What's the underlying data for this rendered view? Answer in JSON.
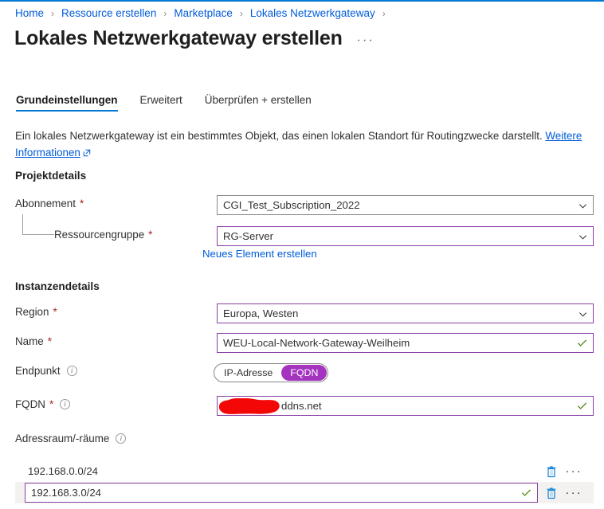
{
  "theme": {
    "accent_blue": "#0078d4",
    "link_blue": "#015cda",
    "purple_border": "#8a3fa4",
    "pill_purple": "#a434c0",
    "required_red": "#a4262c",
    "valid_green": "#498205",
    "selected_row_bg": "#f3f2f1",
    "redaction_red": "#f30707"
  },
  "breadcrumb": {
    "separator": "›",
    "items": [
      {
        "label": "Home"
      },
      {
        "label": "Ressource erstellen"
      },
      {
        "label": "Marketplace"
      },
      {
        "label": "Lokales Netzwerkgateway"
      }
    ]
  },
  "header": {
    "title": "Lokales Netzwerkgateway erstellen",
    "more_actions": "···"
  },
  "tabs": [
    {
      "label": "Grundeinstellungen",
      "active": true
    },
    {
      "label": "Erweitert",
      "active": false
    },
    {
      "label": "Überprüfen + erstellen",
      "active": false
    }
  ],
  "description": {
    "text": "Ein lokales Netzwerkgateway ist ein bestimmtes Objekt, das einen lokalen Standort für Routingzwecke darstellt.",
    "link_text": "Weitere Informationen",
    "link_icon": "external-link-icon"
  },
  "project_details": {
    "heading": "Projektdetails",
    "subscription": {
      "label": "Abonnement",
      "required": "*",
      "value": "CGI_Test_Subscription_2022",
      "icon": "chevron-down-icon"
    },
    "resource_group": {
      "label": "Ressourcengruppe",
      "required": "*",
      "value": "RG-Server",
      "icon": "chevron-down-icon",
      "create_new_link": "Neues Element erstellen"
    }
  },
  "instance_details": {
    "heading": "Instanzendetails",
    "region": {
      "label": "Region",
      "required": "*",
      "value": "Europa, Westen",
      "icon": "chevron-down-icon"
    },
    "name": {
      "label": "Name",
      "required": "*",
      "value": "WEU-Local-Network-Gateway-Weilheim",
      "icon": "checkmark-icon"
    },
    "endpoint": {
      "label": "Endpunkt",
      "info_icon": "info-icon",
      "options": [
        {
          "label": "IP-Adresse",
          "selected": false
        },
        {
          "label": "FQDN",
          "selected": true
        }
      ]
    },
    "fqdn": {
      "label": "FQDN",
      "required": "*",
      "info_icon": "info-icon",
      "value_redacted": "[redacted]",
      "value_suffix": "ddns.net",
      "icon": "checkmark-icon"
    }
  },
  "address_space": {
    "label": "Adressraum/-räume",
    "info_icon": "info-icon",
    "rows": [
      {
        "value": "192.168.0.0/24",
        "editing": false,
        "selected": false,
        "delete_icon": "trash-icon",
        "more_icon": "ellipsis-icon"
      },
      {
        "value": "192.168.3.0/24",
        "editing": true,
        "selected": true,
        "valid_icon": "checkmark-icon",
        "delete_icon": "trash-icon",
        "more_icon": "ellipsis-icon"
      }
    ]
  }
}
